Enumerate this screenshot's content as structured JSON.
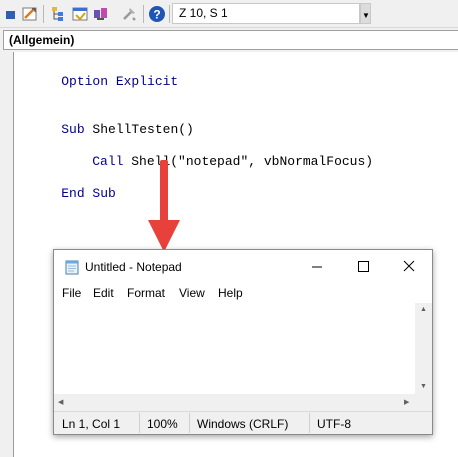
{
  "toolbar": {
    "icons": [
      "view-object-icon",
      "design-mode-icon",
      "project-explorer-icon",
      "properties-window-icon",
      "object-browser-icon",
      "toolbox-icon",
      "help-icon"
    ],
    "position": "Z 10, S 1"
  },
  "object_combo": {
    "value": "(Allgemein)"
  },
  "code": {
    "line1": {
      "kw": "Option Explicit"
    },
    "line2": {
      "kw": "Sub",
      "text": " ShellTesten()"
    },
    "line3": {
      "kw": "Call",
      "text": " Shell(\"notepad\", vbNormalFocus)"
    },
    "line4": {
      "kw": "End Sub"
    }
  },
  "notepad": {
    "title": "Untitled - Notepad",
    "menu": [
      "File",
      "Edit",
      "Format",
      "View",
      "Help"
    ],
    "status": {
      "position": "Ln 1, Col 1",
      "zoom": "100%",
      "line_endings": "Windows (CRLF)",
      "encoding": "UTF-8"
    }
  },
  "colors": {
    "keyword": "#00008b",
    "arrow": "#e8403a"
  }
}
